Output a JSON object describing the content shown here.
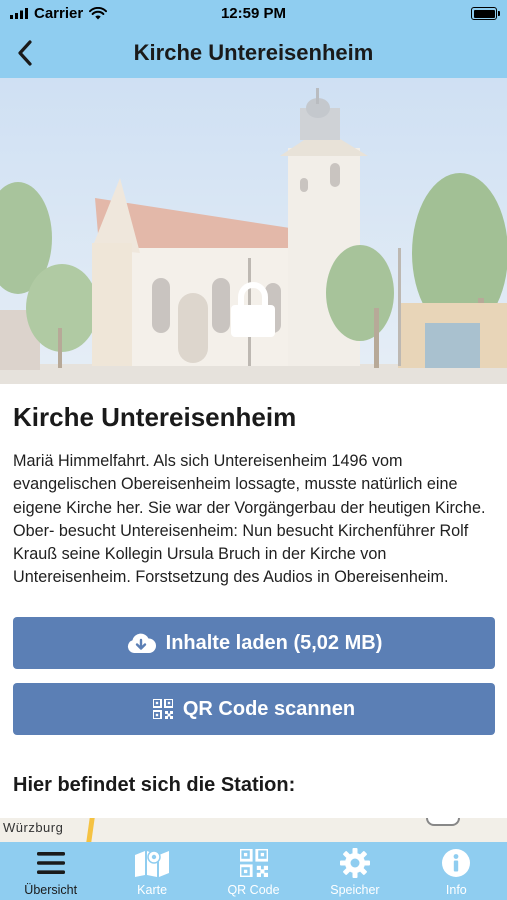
{
  "status_bar": {
    "carrier": "Carrier",
    "time": "12:59 PM"
  },
  "nav": {
    "title": "Kirche Untereisenheim",
    "back_icon": "chevron-left-icon"
  },
  "hero": {
    "locked_icon": "lock-icon"
  },
  "station": {
    "title": "Kirche Untereisenheim",
    "description": "Mariä Himmelfahrt. Als sich Untereisenheim 1496 vom evangelischen Obereisenheim lossagte, musste natürlich eine eigene Kirche her. Sie war der Vorgängerbau der heutigen Kirche. Ober- besucht Untereisenheim: Nun besucht Kirchenführer Rolf Krauß seine Kollegin Ursula Bruch in der Kirche von Untereisenheim. Forstsetzung des Audios in Obereisenheim."
  },
  "buttons": {
    "load": {
      "label": "Inhalte laden (5,02 MB)",
      "icon": "cloud-download-icon"
    },
    "qr": {
      "label": "QR Code scannen",
      "icon": "qr-code-icon"
    }
  },
  "location": {
    "heading": "Hier befindet sich die Station:",
    "map_label": "Würzburg"
  },
  "tabs": [
    {
      "label": "Übersicht",
      "icon": "menu-icon",
      "active": true
    },
    {
      "label": "Karte",
      "icon": "map-icon",
      "active": false
    },
    {
      "label": "QR Code",
      "icon": "qr-code-icon",
      "active": false
    },
    {
      "label": "Speicher",
      "icon": "gear-icon",
      "active": false
    },
    {
      "label": "Info",
      "icon": "info-icon",
      "active": false
    }
  ],
  "colors": {
    "bar": "#8fcdf0",
    "button": "#5b7fb5",
    "tab_inactive": "#ffffff"
  }
}
